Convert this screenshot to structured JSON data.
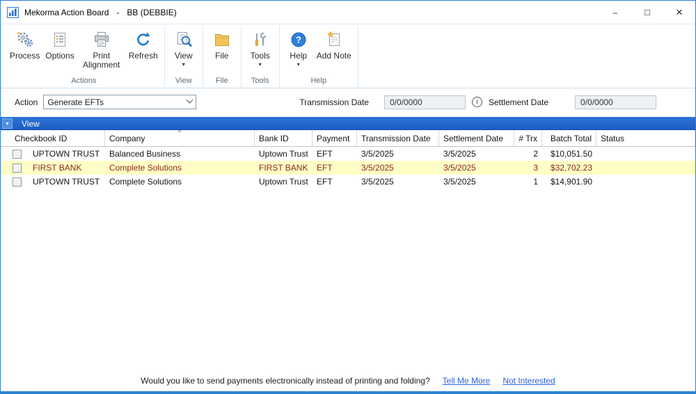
{
  "window": {
    "title": "Mekorma Action Board",
    "dash": "-",
    "user": "BB (DEBBIE)",
    "controls": {
      "minimize": "–",
      "maximize": "□",
      "close": "×"
    }
  },
  "ribbon": {
    "dropdown_glyph": "▾",
    "groups": [
      {
        "label": "Actions"
      },
      {
        "label": "View"
      },
      {
        "label": "File"
      },
      {
        "label": "Tools"
      },
      {
        "label": "Help"
      }
    ],
    "buttons": {
      "process": "Process",
      "options": "Options",
      "print_alignment": "Print Alignment",
      "refresh": "Refresh",
      "view": "View",
      "file": "File",
      "tools": "Tools",
      "help": "Help",
      "add_note": "Add Note"
    }
  },
  "action_bar": {
    "action_label": "Action",
    "action_value": "Generate EFTs",
    "transmission_label": "Transmission Date",
    "transmission_value": "0/0/0000",
    "info_glyph": "i",
    "settlement_label": "Settlement Date",
    "settlement_value": "0/0/0000"
  },
  "view_bar": {
    "label": "View",
    "dropdown_glyph": "▾"
  },
  "table": {
    "sort_indicator": "^",
    "headers": {
      "checkbook": "Checkbook ID",
      "company": "Company",
      "bank": "Bank ID",
      "payment": "Payment",
      "transmission": "Transmission Date",
      "settlement": "Settlement Date",
      "trx": "# Trx",
      "total": "Batch Total",
      "status": "Status"
    },
    "rows": [
      {
        "checkbook": "UPTOWN TRUST",
        "company": "Balanced Business",
        "bank": "Uptown Trust",
        "payment": "EFT",
        "transmission": "3/5/2025",
        "settlement": "3/5/2025",
        "trx": "2",
        "total": "$10,051.50",
        "status": ""
      },
      {
        "checkbook": "FIRST BANK",
        "company": "Complete Solutions",
        "bank": "FIRST BANK",
        "payment": "EFT",
        "transmission": "3/5/2025",
        "settlement": "3/5/2025",
        "trx": "3",
        "total": "$32,702.23",
        "status": ""
      },
      {
        "checkbook": "UPTOWN TRUST",
        "company": "Complete Solutions",
        "bank": "Uptown Trust",
        "payment": "EFT",
        "transmission": "3/5/2025",
        "settlement": "3/5/2025",
        "trx": "1",
        "total": "$14,901.90",
        "status": ""
      }
    ]
  },
  "footer": {
    "message": "Would you like to send payments electronically instead of printing and folding?",
    "link_more": "Tell Me More",
    "link_not": "Not Interested"
  },
  "colors": {
    "accent_blue": "#1f63c8",
    "view_bar_blue": "#2368cd",
    "highlight_row": "#ffffc5",
    "highlight_text": "#8b2626",
    "window_border": "#2e7cd6",
    "link_blue": "#2e62d9"
  }
}
